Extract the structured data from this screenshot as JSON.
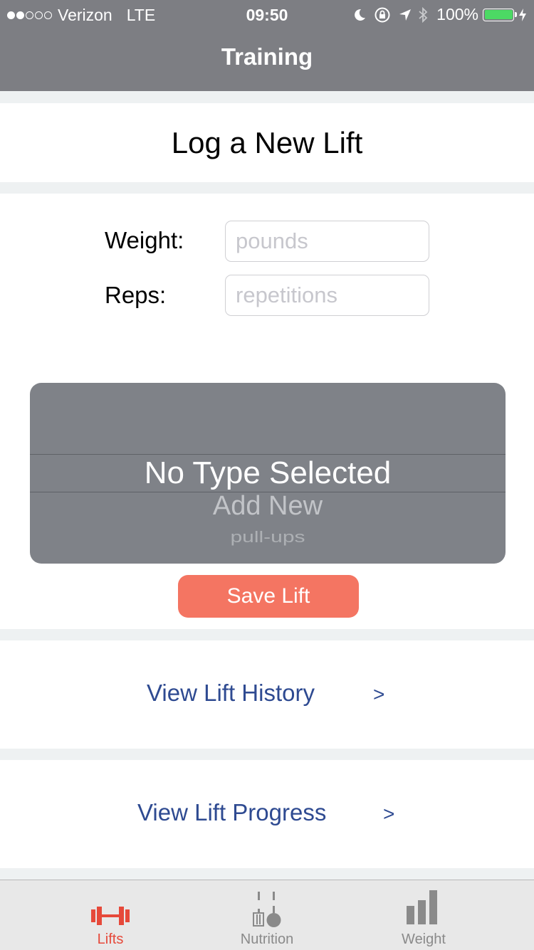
{
  "status_bar": {
    "signal_filled": 2,
    "signal_total": 5,
    "carrier": "Verizon",
    "network": "LTE",
    "time": "09:50",
    "icons": [
      "moon-icon",
      "rotation-lock-icon",
      "location-arrow-icon",
      "bluetooth-icon"
    ],
    "battery": "100%",
    "battery_level": 1.0,
    "battery_color": "#4cd964"
  },
  "nav": {
    "title": "Training"
  },
  "log": {
    "title": "Log a New Lift"
  },
  "form": {
    "weight_label": "Weight:",
    "weight_placeholder": "pounds",
    "weight_value": "",
    "reps_label": "Reps:",
    "reps_placeholder": "repetitions",
    "reps_value": ""
  },
  "picker": {
    "selected": "No Type Selected",
    "options": [
      "Add New",
      "pull-ups"
    ]
  },
  "save_button": "Save Lift",
  "links": {
    "history": {
      "label": "View Lift History",
      "arrow": ">"
    },
    "progress": {
      "label": "View Lift Progress",
      "arrow": ">"
    }
  },
  "tabs": [
    {
      "label": "Lifts",
      "icon": "dumbbell-icon",
      "active": true
    },
    {
      "label": "Nutrition",
      "icon": "fork-spoon-icon",
      "active": false
    },
    {
      "label": "Weight",
      "icon": "bar-chart-icon",
      "active": false
    }
  ],
  "colors": {
    "bar": "#7d7e83",
    "accent": "#f47562",
    "link": "#2e4a91",
    "tab_active": "#e6493a",
    "tab_inactive": "#8a8a8a"
  }
}
